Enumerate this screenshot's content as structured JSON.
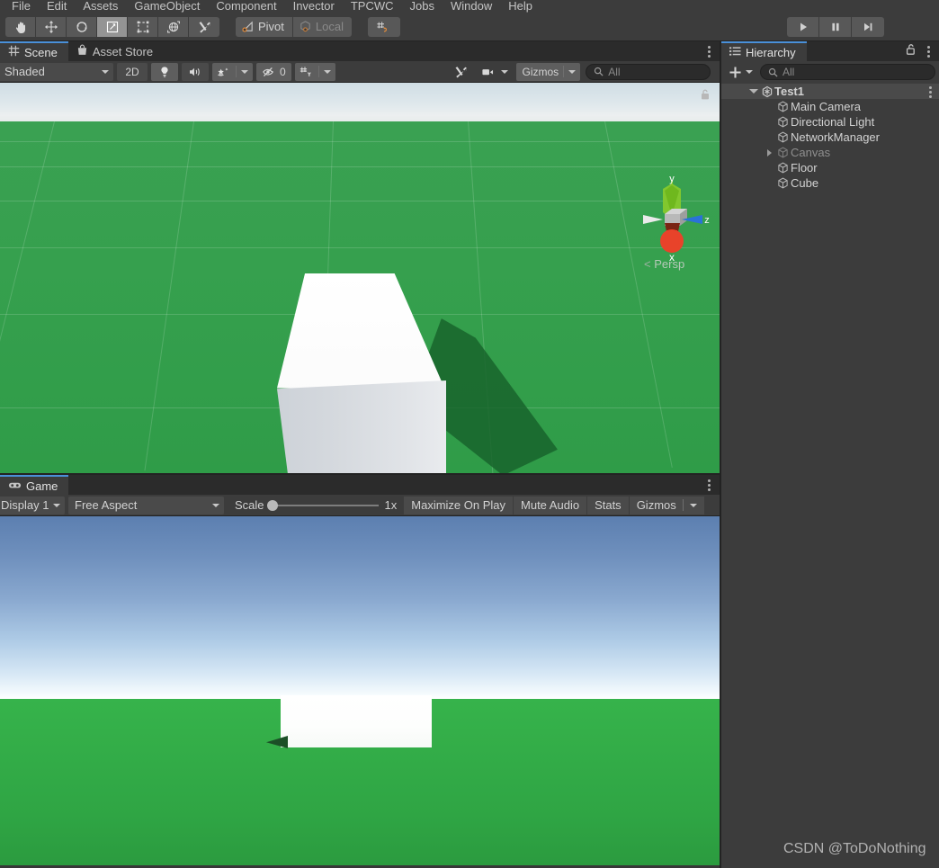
{
  "menubar": {
    "items": [
      "File",
      "Edit",
      "Assets",
      "GameObject",
      "Component",
      "Invector",
      "TPCWC",
      "Jobs",
      "Window",
      "Help"
    ]
  },
  "toolbar": {
    "tools": [
      {
        "name": "hand-tool",
        "icon": "hand-icon",
        "active": false
      },
      {
        "name": "move-tool",
        "icon": "move-arrows-icon",
        "active": false
      },
      {
        "name": "rotate-tool",
        "icon": "rotate-icon",
        "active": false
      },
      {
        "name": "scale-tool",
        "icon": "scale-icon",
        "active": true
      },
      {
        "name": "rect-tool",
        "icon": "rect-transform-icon",
        "active": false
      },
      {
        "name": "transform-tool",
        "icon": "globe-transform-icon",
        "active": false
      },
      {
        "name": "custom-tool",
        "icon": "wrench-screwdriver-icon",
        "active": false
      }
    ],
    "pivot_label": "Pivot",
    "local_label": "Local",
    "snap_icon": "grid-snap-icon",
    "play_label": "play-icon",
    "pause_label": "pause-icon",
    "step_label": "step-icon"
  },
  "scene_panel": {
    "tabs": [
      {
        "label": "Scene",
        "icon": "scene-grid-icon",
        "active": true
      },
      {
        "label": "Asset Store",
        "icon": "shopping-bag-icon",
        "active": false
      }
    ],
    "toolbar": {
      "draw_mode": "Shaded",
      "two_d_label": "2D",
      "lighting_icon": "lightbulb-icon",
      "audio_icon": "speaker-icon",
      "fx_icon": "effects-icon",
      "hidden_count": "0",
      "hidden_icon": "eye-slash-icon",
      "grid_icon": "grid-axis-y-icon",
      "component_icon": "wrench-screwdriver-icon",
      "camera_icon": "camera-icon",
      "gizmos_label": "Gizmos",
      "search_placeholder": "All",
      "search_value": ""
    },
    "gizmo": {
      "x_label": "x",
      "y_label": "y",
      "z_label": "z",
      "projection_label": "Persp",
      "x_color": "#e8432a",
      "y_color": "#7ec820",
      "z_color": "#2a72d8"
    },
    "viewport": {
      "sky_color": "#dfe8ec",
      "ground_color": "#36a04e",
      "object_color": "#ffffff",
      "shadow_color": "#18622b"
    }
  },
  "game_panel": {
    "tab": {
      "label": "Game",
      "icon": "gamepad-icon"
    },
    "toolbar": {
      "display": "Display 1",
      "aspect": "Free Aspect",
      "scale_label": "Scale",
      "scale_value": "1x",
      "maximize_label": "Maximize On Play",
      "mute_label": "Mute Audio",
      "stats_label": "Stats",
      "gizmos_label": "Gizmos"
    },
    "viewport": {
      "sky_top_color": "#5c7fb0",
      "sky_bottom_color": "#ffffff",
      "ground_color": "#33ad48",
      "object_color": "#ffffff"
    }
  },
  "hierarchy": {
    "tab_label": "Hierarchy",
    "tab_icon": "hierarchy-list-icon",
    "lock_icon": "padlock-open-icon",
    "add_label": "+",
    "search_placeholder": "All",
    "search_value": "",
    "items": [
      {
        "label": "Test1",
        "icon": "unity-scene-icon",
        "depth": 0,
        "expanded": true,
        "selected": true,
        "dim": false,
        "has_children": true,
        "kebab": true
      },
      {
        "label": "Main Camera",
        "icon": "gameobject-cube-icon",
        "depth": 1,
        "expanded": false,
        "selected": false,
        "dim": false,
        "has_children": false,
        "kebab": false
      },
      {
        "label": "Directional Light",
        "icon": "gameobject-cube-icon",
        "depth": 1,
        "expanded": false,
        "selected": false,
        "dim": false,
        "has_children": false,
        "kebab": false
      },
      {
        "label": "NetworkManager",
        "icon": "gameobject-cube-icon",
        "depth": 1,
        "expanded": false,
        "selected": false,
        "dim": false,
        "has_children": false,
        "kebab": false
      },
      {
        "label": "Canvas",
        "icon": "gameobject-cube-icon",
        "depth": 1,
        "expanded": false,
        "selected": false,
        "dim": true,
        "has_children": true,
        "kebab": false
      },
      {
        "label": "Floor",
        "icon": "gameobject-cube-icon",
        "depth": 1,
        "expanded": false,
        "selected": false,
        "dim": false,
        "has_children": false,
        "kebab": false
      },
      {
        "label": "Cube",
        "icon": "gameobject-cube-icon",
        "depth": 1,
        "expanded": false,
        "selected": false,
        "dim": false,
        "has_children": false,
        "kebab": false
      }
    ]
  },
  "watermark": "CSDN @ToDoNothing"
}
